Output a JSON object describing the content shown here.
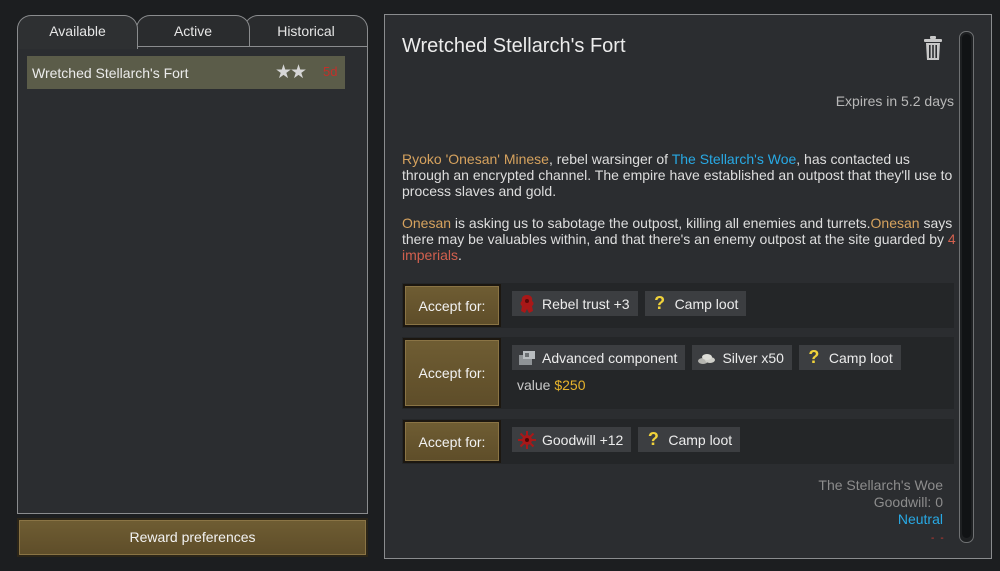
{
  "tabs": [
    {
      "label": "Available",
      "active": true
    },
    {
      "label": "Active",
      "active": false
    },
    {
      "label": "Historical",
      "active": false
    }
  ],
  "quest_list": [
    {
      "name": "Wretched Stellarch's Fort",
      "stars": "★★",
      "star_count": 2,
      "days": "5d"
    }
  ],
  "reward_preferences_label": "Reward preferences",
  "detail": {
    "title": "Wretched Stellarch's Fort",
    "delete_icon": "trash-icon",
    "expires": "Expires in 5.2 days",
    "description": {
      "p1_person": "Ryoko 'Onesan' Minese",
      "p1_a": ", rebel warsinger of ",
      "p1_faction": "The Stellarch's Woe",
      "p1_b": ", has contacted us through an encrypted channel. The empire have established an outpost that they'll use to process slaves and gold.",
      "p2_person1": "Onesan",
      "p2_a": " is asking us to sabotage the outpost, killing all enemies and turrets.",
      "p2_person2": "Onesan",
      "p2_b": " says there may be valuables within, and that there's an enemy outpost at the site guarded by ",
      "p2_enemy": "4 imperials",
      "p2_c": "."
    },
    "options": [
      {
        "accept_label": "Accept for:",
        "rewards": [
          {
            "icon": "rebel-trust-icon",
            "label": "Rebel trust +3"
          },
          {
            "icon": "question-mark-icon",
            "label": "Camp loot"
          }
        ]
      },
      {
        "accept_label": "Accept for:",
        "rewards": [
          {
            "icon": "component-icon",
            "label": "Advanced component"
          },
          {
            "icon": "silver-icon",
            "label": "Silver x50"
          },
          {
            "icon": "question-mark-icon",
            "label": "Camp loot"
          }
        ],
        "value_label": "value ",
        "value_amount": "$250"
      },
      {
        "accept_label": "Accept for:",
        "rewards": [
          {
            "icon": "goodwill-icon",
            "label": "Goodwill +12"
          },
          {
            "icon": "question-mark-icon",
            "label": "Camp loot"
          }
        ]
      }
    ],
    "faction": {
      "name": "The Stellarch's Woe",
      "goodwill": "Goodwill: 0",
      "relation": "Neutral"
    },
    "colors": {
      "person": "#d6a25e",
      "faction": "#28a9e4",
      "enemy": "#d2604e",
      "value": "#e6b32c",
      "days": "#c2302a"
    }
  }
}
